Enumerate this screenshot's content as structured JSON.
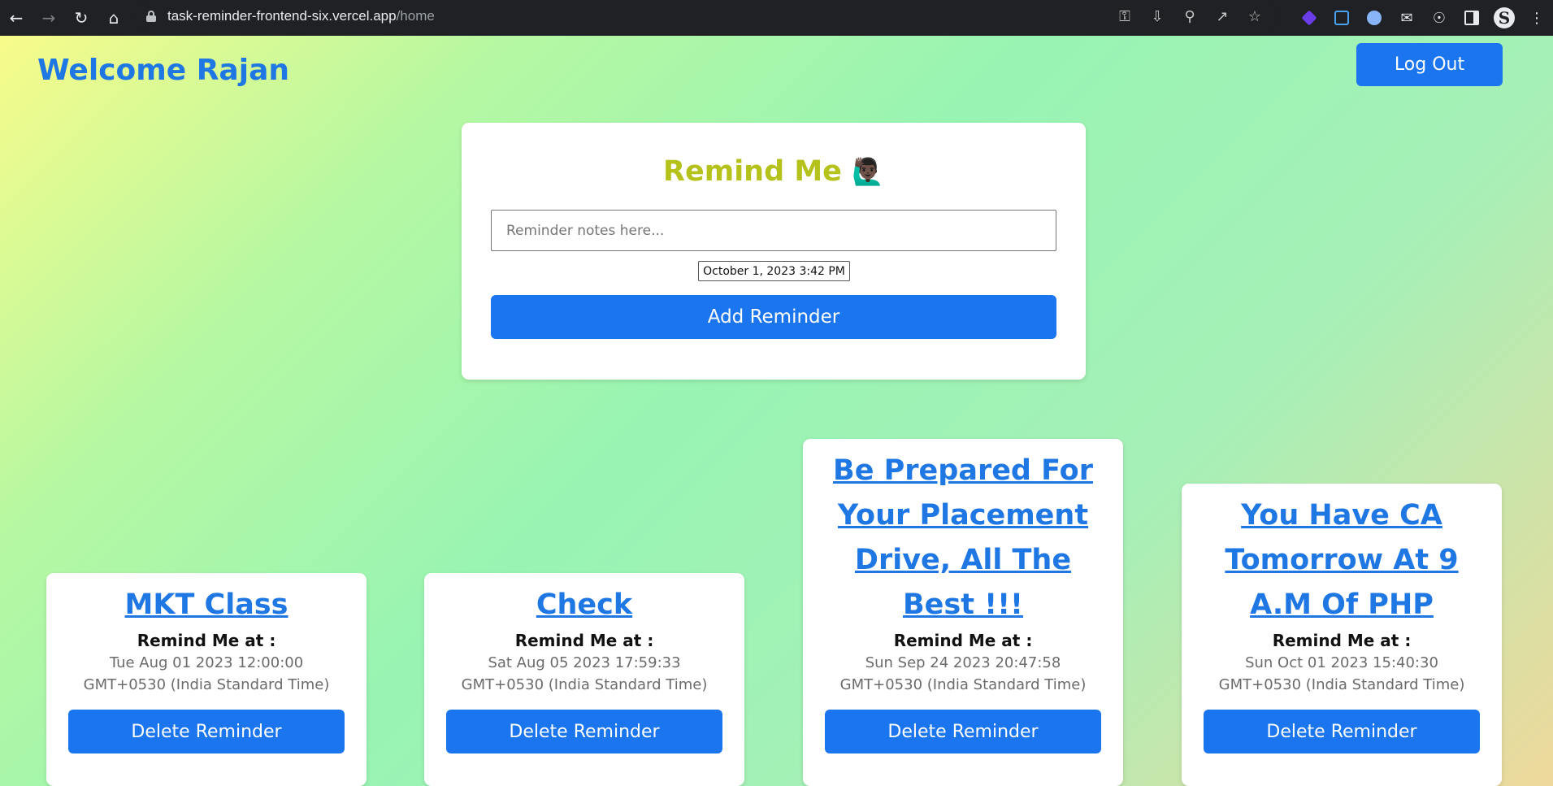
{
  "browser": {
    "url_host": "task-reminder-frontend-six.vercel.app",
    "url_path": "/home",
    "avatar_letter": "S"
  },
  "header": {
    "welcome": "Welcome Rajan",
    "logout_label": "Log Out"
  },
  "form": {
    "title": "Remind Me",
    "title_emoji": "🙋🏿‍♂️",
    "note_placeholder": "Reminder notes here...",
    "datetime_value": "October 1, 2023 3:42 PM",
    "add_label": "Add Reminder"
  },
  "reminders": [
    {
      "title": "MKT Class",
      "remind_label": "Remind Me at :",
      "time": "Tue Aug 01 2023 12:00:00 GMT+0530 (India Standard Time)",
      "delete_label": "Delete Reminder"
    },
    {
      "title": "Check",
      "remind_label": "Remind Me at :",
      "time": "Sat Aug 05 2023 17:59:33 GMT+0530 (India Standard Time)",
      "delete_label": "Delete Reminder"
    },
    {
      "title": "Be Prepared For Your Placement Drive, All The Best !!!",
      "remind_label": "Remind Me at :",
      "time": "Sun Sep 24 2023 20:47:58 GMT+0530 (India Standard Time)",
      "delete_label": "Delete Reminder"
    },
    {
      "title": "You Have CA Tomorrow At 9 A.M Of PHP",
      "remind_label": "Remind Me at :",
      "time": "Sun Oct 01 2023 15:40:30 GMT+0530 (India Standard Time)",
      "delete_label": "Delete Reminder"
    }
  ],
  "colors": {
    "accent": "#1a75ee",
    "welcome": "#1e77e3",
    "form_title": "#b6c21c"
  }
}
